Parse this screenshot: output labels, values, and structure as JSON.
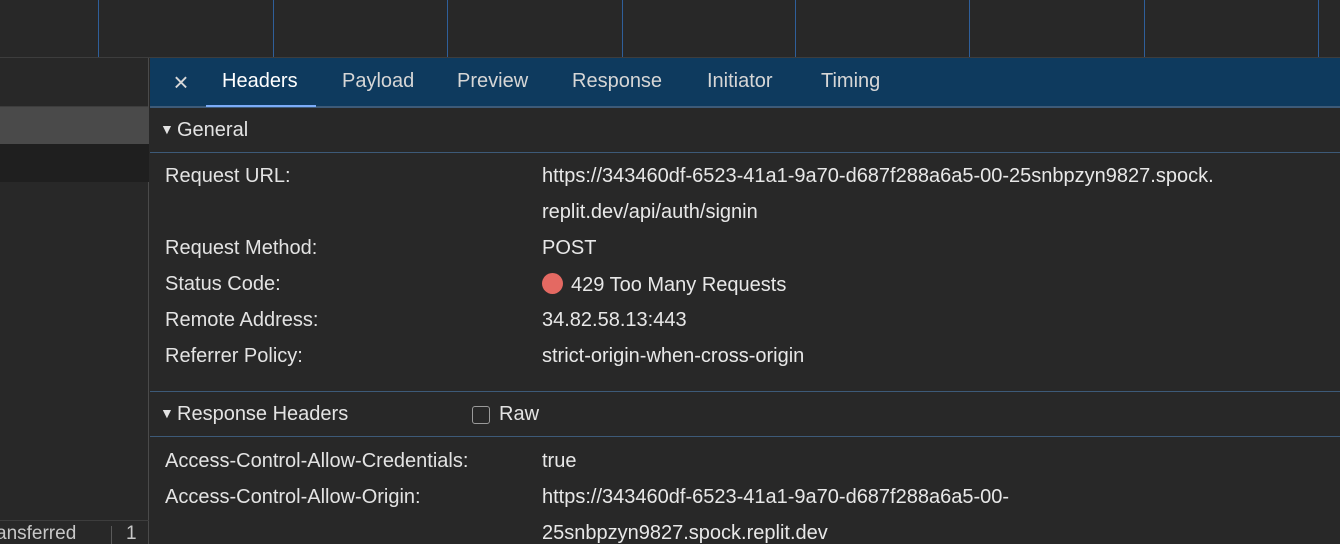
{
  "tabs": {
    "headers": "Headers",
    "payload": "Payload",
    "preview": "Preview",
    "response": "Response",
    "initiator": "Initiator",
    "timing": "Timing"
  },
  "close_icon": "×",
  "general": {
    "title": "General",
    "request_url_label": "Request URL:",
    "request_url_line1": "https://343460df-6523-41a1-9a70-d687f288a6a5-00-25snbpzyn9827.spock.",
    "request_url_line2": "replit.dev/api/auth/signin",
    "request_method_label": "Request Method:",
    "request_method": "POST",
    "status_code_label": "Status Code:",
    "status_code": "429 Too Many Requests",
    "status_color": "#e46962",
    "remote_address_label": "Remote Address:",
    "remote_address": "34.82.58.13:443",
    "referrer_policy_label": "Referrer Policy:",
    "referrer_policy": "strict-origin-when-cross-origin"
  },
  "response_headers": {
    "title": "Response Headers",
    "raw_label": "Raw",
    "acac_label": "Access-Control-Allow-Credentials:",
    "acac_value": "true",
    "acao_label": "Access-Control-Allow-Origin:",
    "acao_line1": "https://343460df-6523-41a1-9a70-d687f288a6a5-00-",
    "acao_line2": "25snbpzyn9827.spock.replit.dev"
  },
  "status_bar": {
    "transferred": "ansferred",
    "count": "1"
  },
  "colors": {
    "tabbar_bg": "#0e3a5e",
    "accent": "#7cacf8",
    "background": "#282828"
  }
}
